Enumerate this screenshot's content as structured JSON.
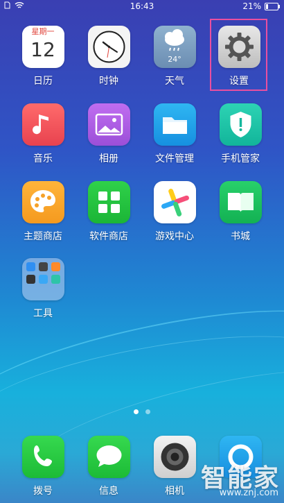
{
  "status_bar": {
    "time": "16:43",
    "battery": "21%",
    "battery_level": 0.21
  },
  "apps": [
    {
      "label": "日历",
      "day_of_week": "星期一",
      "day": "12",
      "icon": "calendar-icon"
    },
    {
      "label": "时钟",
      "icon": "clock-icon"
    },
    {
      "label": "天气",
      "temp": "24°",
      "icon": "weather-icon"
    },
    {
      "label": "设置",
      "icon": "settings-gear-icon"
    },
    {
      "label": "音乐",
      "icon": "music-note-icon"
    },
    {
      "label": "相册",
      "icon": "photo-album-icon"
    },
    {
      "label": "文件管理",
      "icon": "folder-icon"
    },
    {
      "label": "手机管家",
      "icon": "shield-icon"
    },
    {
      "label": "主题商店",
      "icon": "palette-icon"
    },
    {
      "label": "软件商店",
      "icon": "app-grid-icon"
    },
    {
      "label": "游戏中心",
      "icon": "game-center-icon"
    },
    {
      "label": "书城",
      "icon": "book-icon"
    },
    {
      "label": "工具",
      "icon": "folder-tools-icon"
    }
  ],
  "dock": [
    {
      "label": "拨号",
      "icon": "phone-icon"
    },
    {
      "label": "信息",
      "icon": "message-icon"
    },
    {
      "label": "相机",
      "icon": "camera-icon"
    },
    {
      "label": "",
      "icon": "browser-icon"
    }
  ],
  "pager": {
    "pages": 2,
    "current": 1
  },
  "watermark": {
    "text": "智能家",
    "url": "www.znj.com"
  },
  "colors": {
    "highlight": "#e94fa0"
  }
}
